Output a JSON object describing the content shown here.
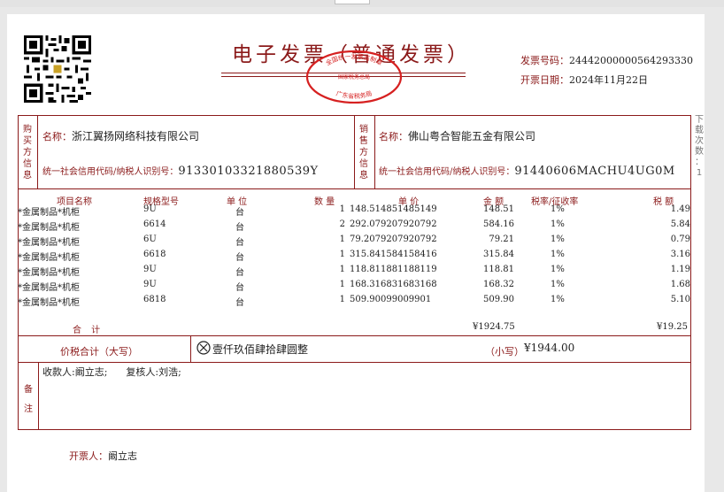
{
  "invoice": {
    "title": "电子发票（普通发票）",
    "number_label": "发票号码：",
    "number": "24442000000564293330",
    "date_label": "开票日期：",
    "date": "2024年11月22日"
  },
  "seal": {
    "top_text": "全国统一发票监制章",
    "middle_text": "国家税务总局",
    "bottom_text": "广东省税务局"
  },
  "buyer": {
    "section_label": [
      "购",
      "买",
      "方",
      "信",
      "息"
    ],
    "name_label": "名称：",
    "name": "浙江翼扬网络科技有限公司",
    "tax_label": "统一社会信用代码/纳税人识别号：",
    "tax_id": "91330103321880539Y"
  },
  "seller": {
    "section_label": [
      "销",
      "售",
      "方",
      "信",
      "息"
    ],
    "name_label": "名称：",
    "name": "佛山粤合智能五金有限公司",
    "tax_label": "统一社会信用代码/纳税人识别号：",
    "tax_id": "91440606MACHU4UG0M"
  },
  "items_header": {
    "name": "项目名称",
    "spec": "规格型号",
    "unit": "单  位",
    "qty": "数  量",
    "price": "单  价",
    "amount": "金  额",
    "rate": "税率/征收率",
    "tax": "税  额"
  },
  "items": [
    {
      "name": "*金属制品*机柜",
      "spec": "9U",
      "unit": "台",
      "qty": "1",
      "price": "148.514851485149",
      "amount": "148.51",
      "rate": "1%",
      "tax": "1.49"
    },
    {
      "name": "*金属制品*机柜",
      "spec": "6614",
      "unit": "台",
      "qty": "2",
      "price": "292.079207920792",
      "amount": "584.16",
      "rate": "1%",
      "tax": "5.84"
    },
    {
      "name": "*金属制品*机柜",
      "spec": "6U",
      "unit": "台",
      "qty": "1",
      "price": "79.2079207920792",
      "amount": "79.21",
      "rate": "1%",
      "tax": "0.79"
    },
    {
      "name": "*金属制品*机柜",
      "spec": "6618",
      "unit": "台",
      "qty": "1",
      "price": "315.841584158416",
      "amount": "315.84",
      "rate": "1%",
      "tax": "3.16"
    },
    {
      "name": "*金属制品*机柜",
      "spec": "9U",
      "unit": "台",
      "qty": "1",
      "price": "118.811881188119",
      "amount": "118.81",
      "rate": "1%",
      "tax": "1.19"
    },
    {
      "name": "*金属制品*机柜",
      "spec": "9U",
      "unit": "台",
      "qty": "1",
      "price": "168.316831683168",
      "amount": "168.32",
      "rate": "1%",
      "tax": "1.68"
    },
    {
      "name": "*金属制品*机柜",
      "spec": "6818",
      "unit": "台",
      "qty": "1",
      "price": "509.90099009901",
      "amount": "509.90",
      "rate": "1%",
      "tax": "5.10"
    }
  ],
  "totals": {
    "label": "合  计",
    "amount": "¥1924.75",
    "tax": "¥19.25"
  },
  "grand_total": {
    "label": "价税合计（大写）",
    "uppercase": "壹仟玖佰肆拾肆圆整",
    "lower_label": "（小写）",
    "lowercase": "¥1944.00"
  },
  "remarks": {
    "section_label": [
      "备",
      "注"
    ],
    "text": "收款人:阚立志;      复核人:刘浩;"
  },
  "issuer": {
    "label": "开票人：",
    "name": "阚立志"
  },
  "side_note": [
    "下",
    "载",
    "次",
    "数",
    "：",
    "1"
  ]
}
